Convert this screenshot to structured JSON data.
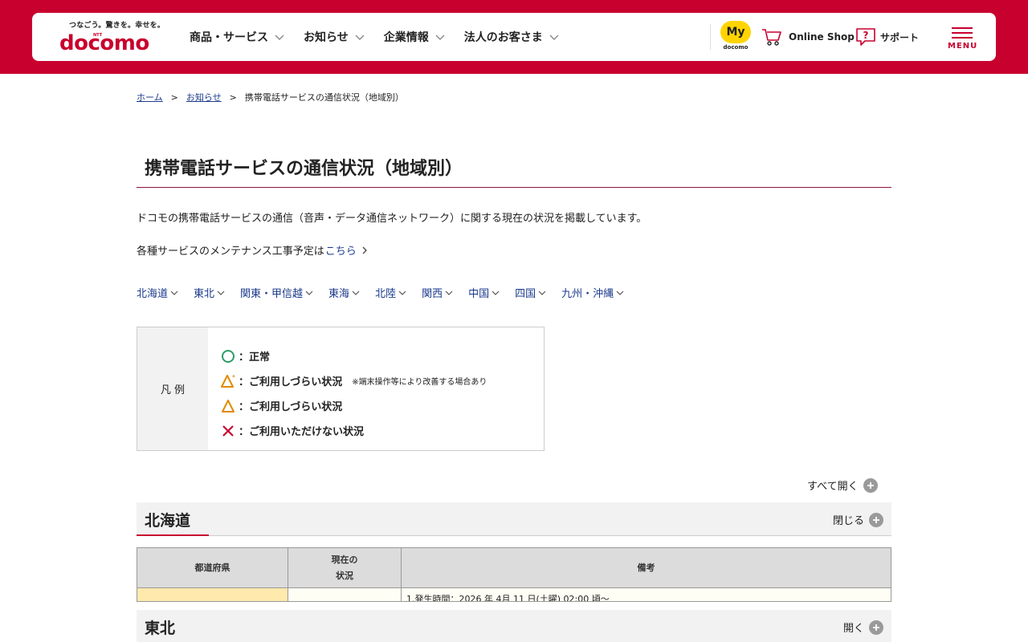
{
  "header": {
    "tagline": "つなごう。驚きを。幸せを。",
    "logo_ntt": "NTT",
    "logo_text": "docomo",
    "nav": [
      {
        "label": "商品・サービス"
      },
      {
        "label": "お知らせ"
      },
      {
        "label": "企業情報"
      },
      {
        "label": "法人のお客さま"
      }
    ],
    "mydocomo_badge": "My",
    "mydocomo_sub": "docomo",
    "online_shop": "Online Shop",
    "support": "サポート",
    "menu": "MENU"
  },
  "breadcrumb": {
    "home": "ホーム",
    "news": "お知らせ",
    "current": "携帯電話サービスの通信状況（地域別）",
    "separator": ">"
  },
  "page": {
    "title": "携帯電話サービスの通信状況（地域別）",
    "intro": "ドコモの携帯電話サービスの通信（音声・データ通信ネットワーク）に関する現在の状況を掲載しています。",
    "maintenance_prefix": "各種サービスのメンテナンス工事予定は",
    "maintenance_link": "こちら"
  },
  "regions": [
    "北海道",
    "東北",
    "関東・甲信越",
    "東海",
    "北陸",
    "関西",
    "中国",
    "四国",
    "九州・沖縄"
  ],
  "legend": {
    "heading": "凡 例",
    "items": [
      {
        "icon": "circle-icon",
        "label": "：正常",
        "note": ""
      },
      {
        "icon": "triangle-asterisk-icon",
        "label": "：ご利用しづらい状況",
        "note": "※端末操作等により改善する場合あり"
      },
      {
        "icon": "triangle-icon",
        "label": "：ご利用しづらい状況",
        "note": ""
      },
      {
        "icon": "cross-icon",
        "label": "：ご利用いただけない状況",
        "note": ""
      }
    ]
  },
  "open_all": "すべて開く",
  "sections": [
    {
      "name": "北海道",
      "toggle": "閉じる"
    },
    {
      "name": "東北",
      "toggle": "開く"
    }
  ],
  "table": {
    "headers": [
      "都道府県",
      "現在の\n状況",
      "備考"
    ],
    "first_row_note": "1.発生時間：2026 年 4月 11 日(土曜) 02:00 頃～"
  },
  "colors": {
    "brand_red": "#c8002e",
    "link_blue": "#1a3a8c",
    "yellow": "#ffd400",
    "status_green": "#2e9b6a",
    "status_orange": "#e08a00",
    "status_red": "#c8002e"
  }
}
